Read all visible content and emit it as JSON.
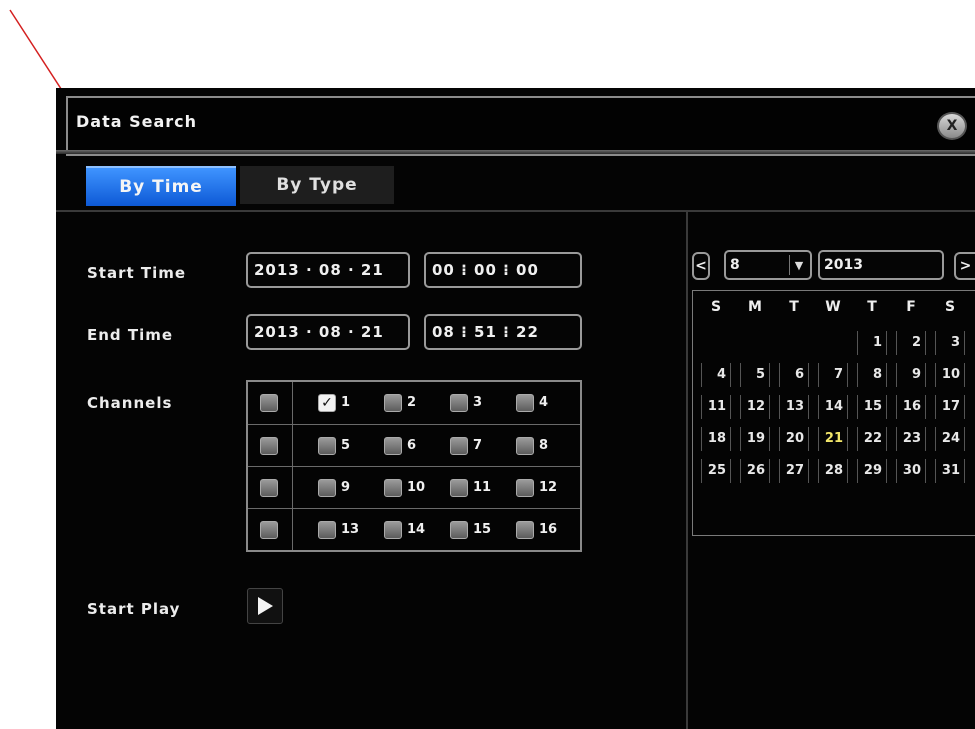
{
  "window": {
    "title": "Data Search",
    "close_label": "X"
  },
  "tabs": [
    {
      "label": "By Time",
      "active": true
    },
    {
      "label": "By Type",
      "active": false
    }
  ],
  "form": {
    "start_time": {
      "label": "Start Time",
      "date": "2013 · 08 · 21",
      "time": "00 ⁝ 00 ⁝ 00"
    },
    "end_time": {
      "label": "End Time",
      "date": "2013 · 08 · 21",
      "time": "08 ⁝ 51 ⁝ 22"
    },
    "channels_label": "Channels",
    "channels": [
      {
        "n": "1",
        "checked": true
      },
      {
        "n": "2",
        "checked": false
      },
      {
        "n": "3",
        "checked": false
      },
      {
        "n": "4",
        "checked": false
      },
      {
        "n": "5",
        "checked": false
      },
      {
        "n": "6",
        "checked": false
      },
      {
        "n": "7",
        "checked": false
      },
      {
        "n": "8",
        "checked": false
      },
      {
        "n": "9",
        "checked": false
      },
      {
        "n": "10",
        "checked": false
      },
      {
        "n": "11",
        "checked": false
      },
      {
        "n": "12",
        "checked": false
      },
      {
        "n": "13",
        "checked": false
      },
      {
        "n": "14",
        "checked": false
      },
      {
        "n": "15",
        "checked": false
      },
      {
        "n": "16",
        "checked": false
      }
    ],
    "start_play_label": "Start Play"
  },
  "calendar": {
    "prev_label": "<",
    "next_label": ">",
    "month": "8",
    "year": "2013",
    "weekdays": [
      "S",
      "M",
      "T",
      "W",
      "T",
      "F",
      "S"
    ],
    "weeks": [
      [
        "",
        "",
        "",
        "",
        "1",
        "2",
        "3"
      ],
      [
        "4",
        "5",
        "6",
        "7",
        "8",
        "9",
        "10"
      ],
      [
        "11",
        "12",
        "13",
        "14",
        "15",
        "16",
        "17"
      ],
      [
        "18",
        "19",
        "20",
        "21",
        "22",
        "23",
        "24"
      ],
      [
        "25",
        "26",
        "27",
        "28",
        "29",
        "30",
        "31"
      ]
    ],
    "selected_day": "21"
  },
  "colors": {
    "tab_active": "#1e6cf0",
    "today": "#f2e66a",
    "annotation_arrow": "#d42020"
  }
}
